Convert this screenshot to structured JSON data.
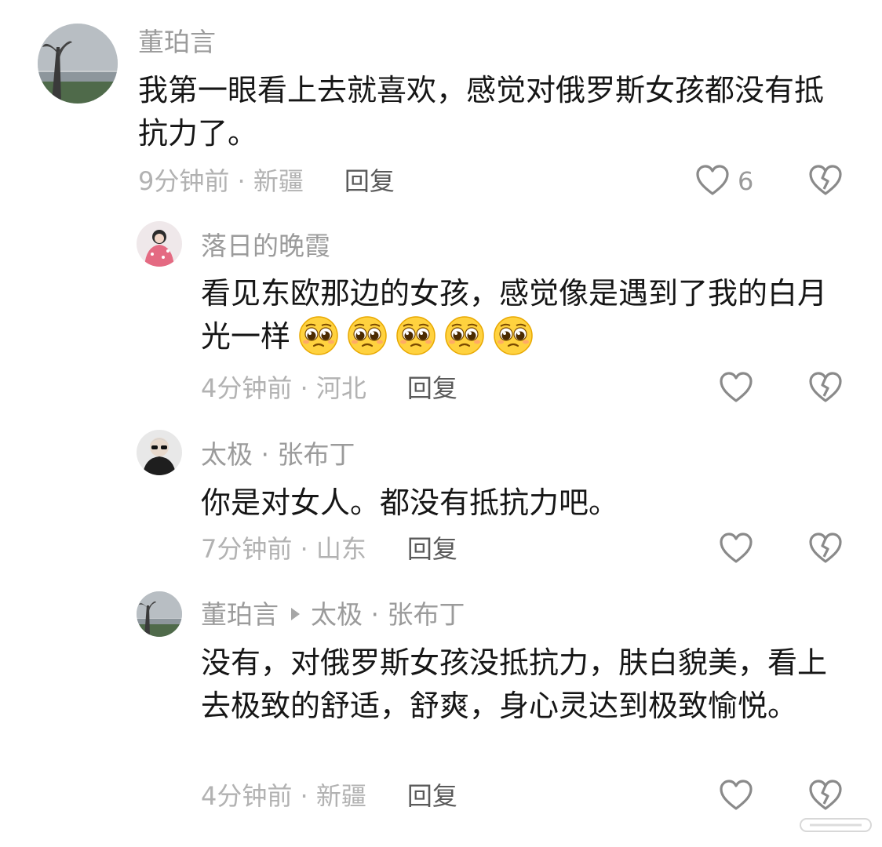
{
  "comments": [
    {
      "username": "董珀言",
      "text": "我第一眼看上去就喜欢，感觉对俄罗斯女孩都没有抵抗力了。",
      "time_location": "9分钟前 · 新疆",
      "reply_label": "回复",
      "like_count": "6",
      "icons": {
        "like": "heart-outline-icon",
        "dislike": "broken-heart-icon"
      }
    },
    {
      "username": "落日的晚霞",
      "text": "看见东欧那边的女孩，感觉像是遇到了我的白月光一样",
      "emoji_count": 5,
      "emoji_name": "pleading-face-emoji",
      "time_location": "4分钟前 · 河北",
      "reply_label": "回复"
    },
    {
      "username": "太极 · 张布丁",
      "text": "你是对女人。都没有抵抗力吧。",
      "time_location": "7分钟前 · 山东",
      "reply_label": "回复"
    },
    {
      "username": "董珀言",
      "reply_to": "太极 · 张布丁",
      "text": "没有，对俄罗斯女孩没抵抗力，肤白貌美，看上去极致的舒适，舒爽，身心灵达到极致愉悦。",
      "time_location": "4分钟前 · 新疆",
      "reply_label": "回复"
    }
  ],
  "colors": {
    "username": "#9b9b9b",
    "meta": "#b2b2b2",
    "reply": "#5a5a5a",
    "text": "#161616",
    "icon": "#8a8a8a"
  }
}
